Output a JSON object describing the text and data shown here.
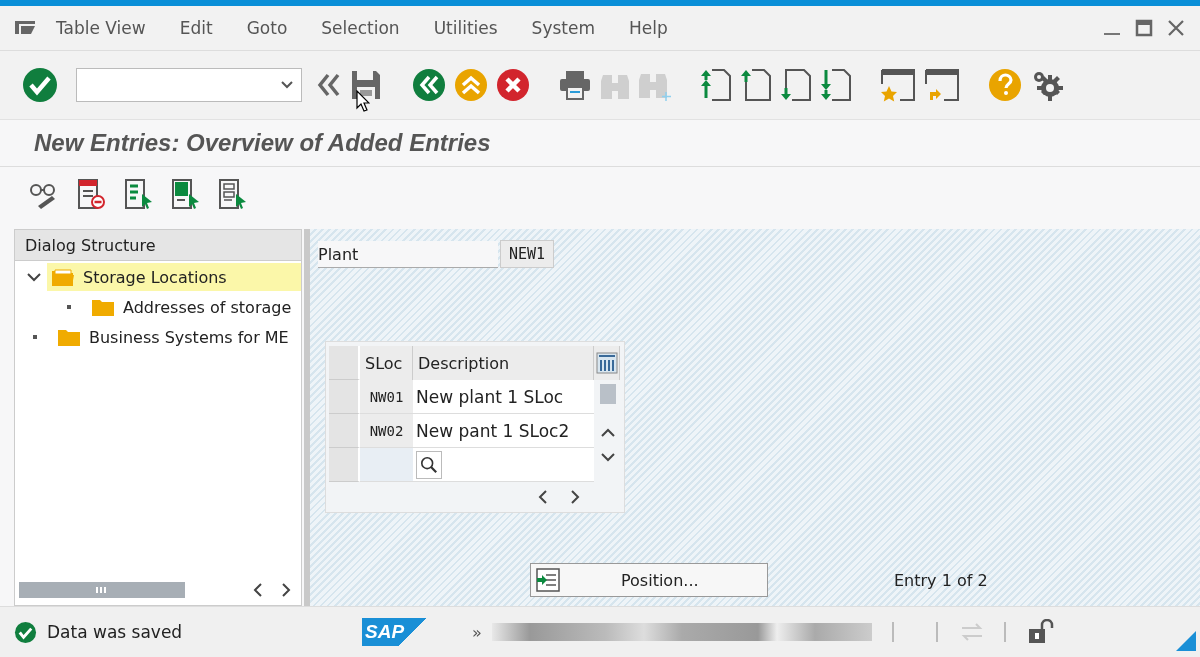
{
  "menu_bar": {
    "items": [
      {
        "label": "Table View"
      },
      {
        "label": "Edit"
      },
      {
        "label": "Goto"
      },
      {
        "label": "Selection"
      },
      {
        "label": "Utilities"
      },
      {
        "label": "System"
      },
      {
        "label": "Help"
      }
    ]
  },
  "screen_title": "New Entries: Overview of Added Entries",
  "dialog_structure": {
    "title": "Dialog Structure",
    "items": [
      {
        "label": "Storage Locations",
        "selected": true,
        "expanded": true,
        "children": [
          {
            "label": "Addresses of storage",
            "selected": false
          }
        ]
      },
      {
        "label": "Business Systems for ME",
        "selected": false
      }
    ]
  },
  "plant": {
    "label": "Plant",
    "value": "NEW1"
  },
  "table": {
    "columns": [
      "SLoc",
      "Description"
    ],
    "rows": [
      [
        "NW01",
        "New plant 1 SLoc"
      ],
      [
        "NW02",
        "New pant 1 SLoc2"
      ]
    ]
  },
  "position_button": "Position...",
  "entry_info": "Entry 1 of 2",
  "status_bar": {
    "message": "Data was saved",
    "logo": "SAP",
    "more": "»"
  }
}
